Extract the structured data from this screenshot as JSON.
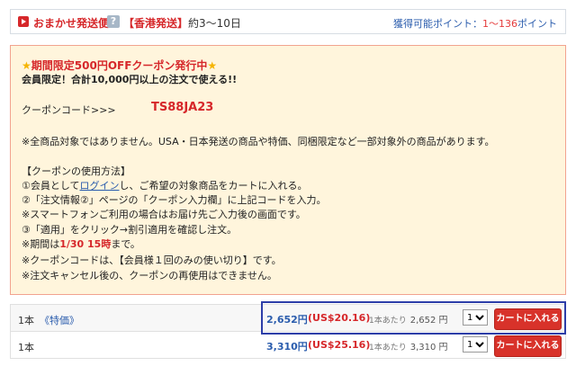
{
  "shipping": {
    "method": "おまかせ発送便",
    "help_icon": "?",
    "origin": "【香港発送】",
    "days": "約3〜10日",
    "points_label": "獲得可能ポイント：",
    "points_value": "1〜136",
    "points_unit": "ポイント"
  },
  "coupon": {
    "title_star_left": "★",
    "title": "期間限定500円OFFクーポン発行中",
    "title_star_right": "★",
    "subtitle": "会員限定！合計10,000円以上の注文で使える!!",
    "code_label": "クーポンコード>>>",
    "code": "TS88JA23",
    "notice": "※全商品対象ではありません。USA・日本発送の商品や特価、同梱限定など一部対象外の商品があります。",
    "howto_title": "【クーポンの使用方法】",
    "step1_pre": "①会員として",
    "step1_link": "ログイン",
    "step1_post": "し、ご希望の対象商品をカートに入れる。",
    "step2": "②「注文情報②」ページの「クーポン入力欄」に上記コードを入力。",
    "step3": "※スマートフォンご利用の場合はお届け先ご入力後の画面です。",
    "step4": "③「適用」をクリック→割引適用を確認し注文。",
    "period_pre": "※期間は",
    "period_value": "1/30 15時",
    "period_post": "まで。",
    "limit": "※クーポンコードは、【会員様１回のみの使い切り】です。",
    "cancel": "※注文キャンセル後の、クーポンの再使用はできません。"
  },
  "rows": [
    {
      "qty": "1本",
      "tag": "《特価》",
      "price": "2,652円",
      "usd": "(US$20.16)",
      "unit_label": "1本あたり",
      "unit_price": "2,652 円",
      "select_value": "1",
      "cart_label": "カートに入れる"
    },
    {
      "qty": "1本",
      "tag": "",
      "price": "3,310円",
      "usd": "(US$25.16)",
      "unit_label": "1本あたり",
      "unit_price": "3,310 円",
      "select_value": "1",
      "cart_label": "カートに入れる"
    }
  ]
}
